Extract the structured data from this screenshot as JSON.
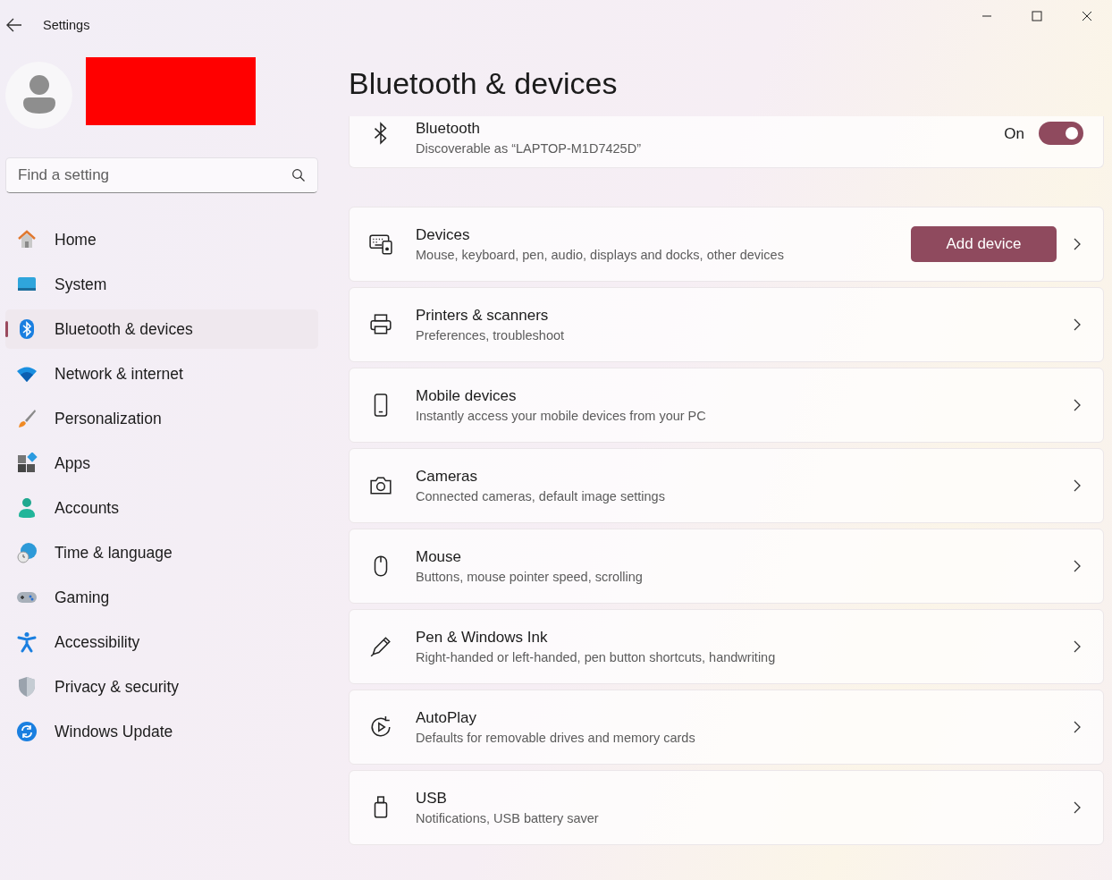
{
  "window": {
    "title": "Settings"
  },
  "search": {
    "placeholder": "Find a setting"
  },
  "sidebar": {
    "items": [
      {
        "label": "Home",
        "selected": false
      },
      {
        "label": "System",
        "selected": false
      },
      {
        "label": "Bluetooth & devices",
        "selected": true
      },
      {
        "label": "Network & internet",
        "selected": false
      },
      {
        "label": "Personalization",
        "selected": false
      },
      {
        "label": "Apps",
        "selected": false
      },
      {
        "label": "Accounts",
        "selected": false
      },
      {
        "label": "Time & language",
        "selected": false
      },
      {
        "label": "Gaming",
        "selected": false
      },
      {
        "label": "Accessibility",
        "selected": false
      },
      {
        "label": "Privacy & security",
        "selected": false
      },
      {
        "label": "Windows Update",
        "selected": false
      }
    ]
  },
  "page": {
    "title": "Bluetooth & devices"
  },
  "bluetooth": {
    "title": "Bluetooth",
    "subtitle": "Discoverable as “LAPTOP-M1D7425D”",
    "state_label": "On",
    "on": true
  },
  "cards": [
    {
      "title": "Devices",
      "subtitle": "Mouse, keyboard, pen, audio, displays and docks, other devices",
      "button": "Add device"
    },
    {
      "title": "Printers & scanners",
      "subtitle": "Preferences, troubleshoot"
    },
    {
      "title": "Mobile devices",
      "subtitle": "Instantly access your mobile devices from your PC"
    },
    {
      "title": "Cameras",
      "subtitle": "Connected cameras, default image settings"
    },
    {
      "title": "Mouse",
      "subtitle": "Buttons, mouse pointer speed, scrolling"
    },
    {
      "title": "Pen & Windows Ink",
      "subtitle": "Right-handed or left-handed, pen button shortcuts, handwriting"
    },
    {
      "title": "AutoPlay",
      "subtitle": "Defaults for removable drives and memory cards"
    },
    {
      "title": "USB",
      "subtitle": "Notifications, USB battery saver"
    }
  ]
}
